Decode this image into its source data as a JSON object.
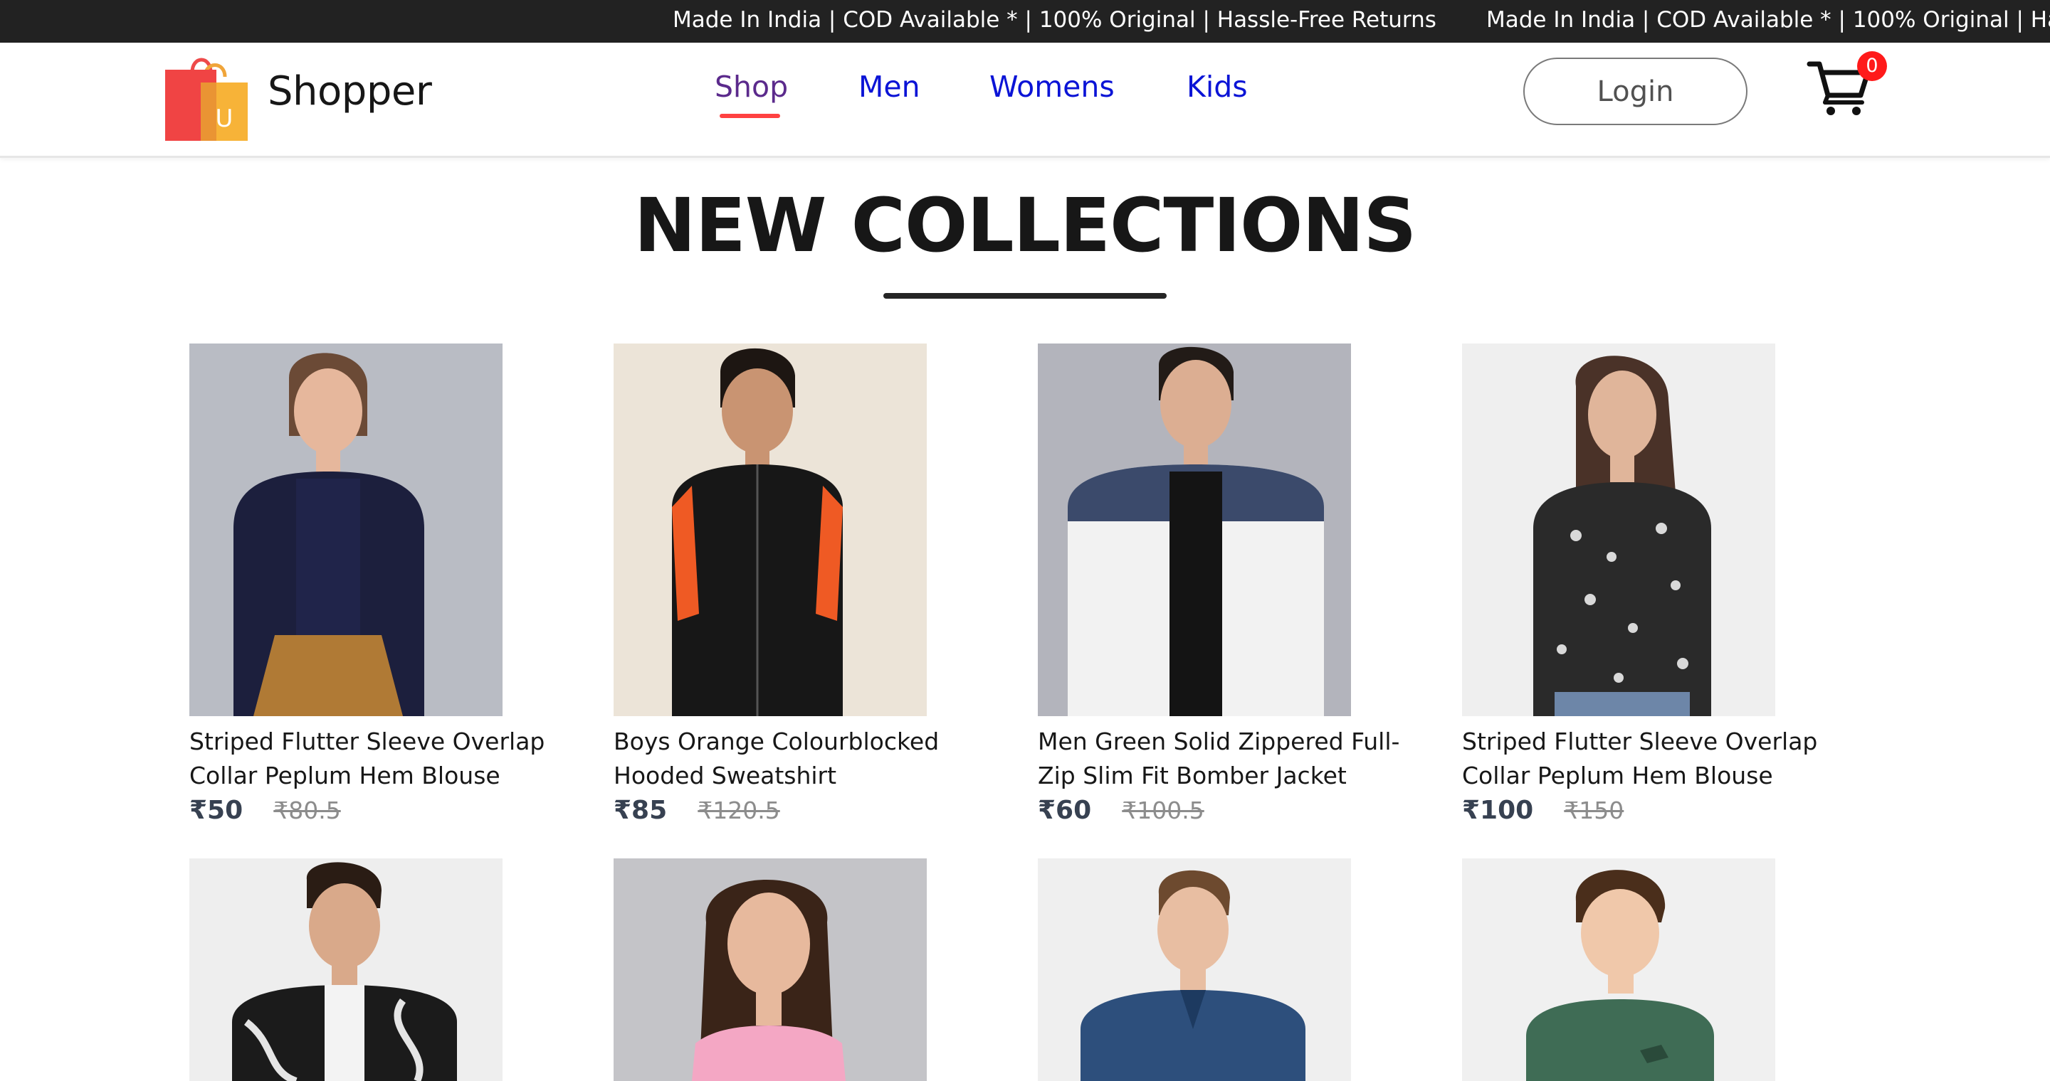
{
  "announcement": {
    "text": "Made In India | COD Available * | 100% Original | Hassle-Free Returns",
    "text_repeat": "Made In India | COD Available * | 100% Original | Ha"
  },
  "header": {
    "brand": "Shopper",
    "nav": [
      {
        "label": "Shop",
        "active": true
      },
      {
        "label": "Men"
      },
      {
        "label": "Womens"
      },
      {
        "label": "Kids"
      }
    ],
    "login_label": "Login",
    "cart_count": "0"
  },
  "section": {
    "title": "NEW COLLECTIONS"
  },
  "products": [
    {
      "name": "Striped Flutter Sleeve Overlap Collar Peplum Hem Blouse",
      "new_price": "₹50",
      "old_price": "₹80.5"
    },
    {
      "name": "Boys Orange Colourblocked Hooded Sweatshirt",
      "new_price": "₹85",
      "old_price": "₹120.5"
    },
    {
      "name": "Men Green Solid Zippered Full-Zip Slim Fit Bomber Jacket",
      "new_price": "₹60",
      "old_price": "₹100.5"
    },
    {
      "name": "Striped Flutter Sleeve Overlap Collar Peplum Hem Blouse",
      "new_price": "₹100",
      "old_price": "₹150"
    }
  ],
  "colors": {
    "topbar_bg": "#222222",
    "nav_link": "#0b14d6",
    "nav_active": "#5b2a8c",
    "accent_underline": "#ff4141",
    "cart_badge": "#ff1a1a"
  }
}
